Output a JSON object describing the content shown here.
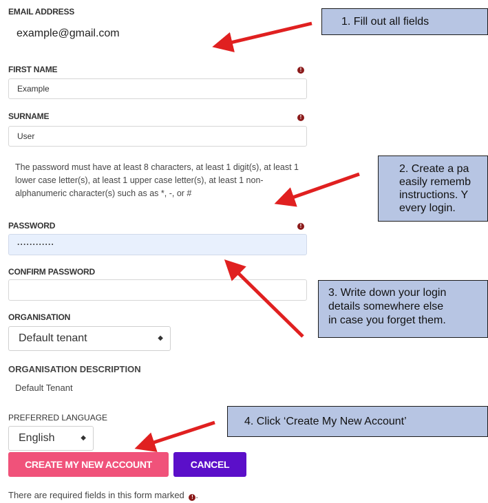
{
  "form": {
    "email_label": "EMAIL ADDRESS",
    "email_value": "example@gmail.com",
    "first_name_label": "FIRST NAME",
    "first_name_value": "Example",
    "surname_label": "SURNAME",
    "surname_value": "User",
    "password_rules": "The password must have at least 8 characters, at least 1 digit(s), at least 1 lower case letter(s), at least 1 upper case letter(s), at least 1 non-alphanumeric character(s) such as as *, -, or #",
    "password_label": "PASSWORD",
    "password_value": "············",
    "confirm_password_label": "CONFIRM PASSWORD",
    "confirm_password_value": "",
    "organisation_label": "ORGANISATION",
    "organisation_value": "Default tenant",
    "organisation_description_label": "ORGANISATION DESCRIPTION",
    "organisation_description_value": "Default Tenant",
    "preferred_language_label": "PREFERRED LANGUAGE",
    "preferred_language_value": "English",
    "required_icon": "!",
    "select_chevron": "◆",
    "create_button": "CREATE MY NEW ACCOUNT",
    "cancel_button": "CANCEL",
    "required_note": "There are required fields in this form marked",
    "required_note_end": "."
  },
  "callouts": {
    "step1": "1.      Fill out all fields",
    "step2_line1": "2. Create a pa",
    "step2_line2": "easily rememb",
    "step2_line3": "instructions. Y",
    "step2_line4": "every login.",
    "step3_line1": "3. Write down your login",
    "step3_line2": "details somewhere else",
    "step3_line3": "in case you forget them.",
    "step4": "4. Click ‘Create My New Account’"
  },
  "colors": {
    "create_button": "#f0527a",
    "cancel_button": "#5b0fc9",
    "callout_fill": "#b7c5e3",
    "arrow": "#e02020",
    "required_icon": "#8b1a1a",
    "password_field_fill": "#e8f0fd"
  }
}
